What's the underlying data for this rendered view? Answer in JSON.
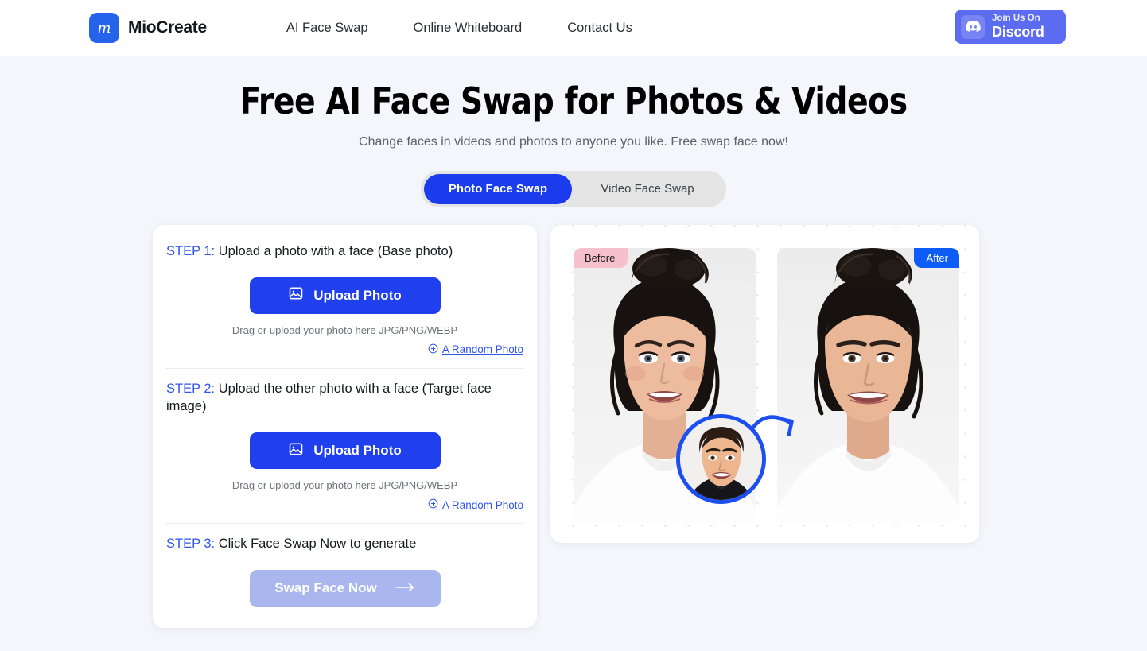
{
  "header": {
    "brand_name": "MioCreate",
    "logo_icon": "miocreate-m-logo",
    "nav": [
      {
        "label": "AI Face Swap"
      },
      {
        "label": "Online Whiteboard"
      },
      {
        "label": "Contact Us"
      }
    ],
    "discord": {
      "icon": "discord-icon",
      "top_label": "Join Us On",
      "bottom_label": "Discord",
      "color": "#5c6cf0"
    }
  },
  "hero": {
    "title": "Free AI Face Swap for Photos & Videos",
    "subtitle": "Change faces in videos and photos to anyone you like. Free swap face now!"
  },
  "tabs": {
    "active_index": 0,
    "items": [
      {
        "label": "Photo Face Swap",
        "active": true
      },
      {
        "label": "Video Face Swap",
        "active": false
      }
    ],
    "active_color": "#1a3ced",
    "track_color": "#e4e4e4"
  },
  "steps": [
    {
      "number_label": "STEP 1:",
      "title": "Upload a photo with a face (Base photo)",
      "upload_button": "Upload Photo",
      "upload_icon": "image-upload-icon",
      "hint": "Drag or upload your photo here JPG/PNG/WEBP",
      "random_link": "A Random Photo",
      "random_icon": "plus-circle-icon"
    },
    {
      "number_label": "STEP 2:",
      "title": "Upload the other photo with a face (Target face image)",
      "upload_button": "Upload Photo",
      "upload_icon": "image-upload-icon",
      "hint": "Drag or upload your photo here JPG/PNG/WEBP",
      "random_link": "A Random Photo",
      "random_icon": "plus-circle-icon"
    },
    {
      "number_label": "STEP 3:",
      "title": "Click Face Swap Now to generate",
      "submit_button": "Swap Face Now",
      "submit_icon": "arrow-right-icon",
      "submit_disabled": true
    }
  ],
  "preview": {
    "before_badge": "Before",
    "after_badge": "After",
    "before_badge_color": "#f6c0cc",
    "after_badge_color": "#0d5cf5",
    "source_face_label": "source-face-thumbnail",
    "arrow_icon": "curved-arrow-right-icon",
    "accent_color": "#1c4ef0"
  },
  "colors": {
    "page_background": "#f5f6fb",
    "primary_blue": "#1f40ec",
    "link_blue": "#2f55ef",
    "disabled_blue": "#a9b7ee"
  }
}
